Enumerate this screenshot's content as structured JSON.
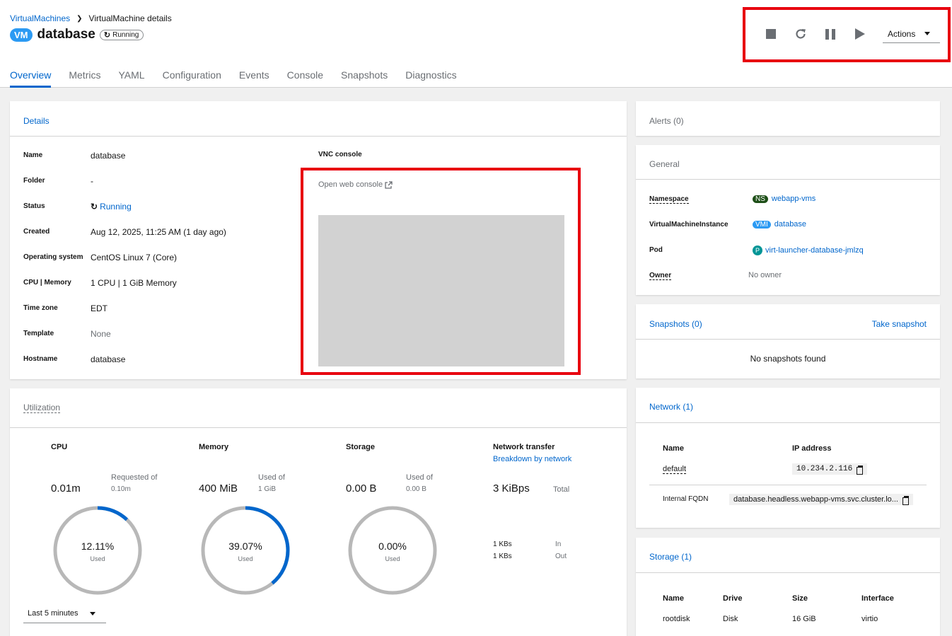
{
  "breadcrumb": {
    "parent": "VirtualMachines",
    "current": "VirtualMachine details"
  },
  "header": {
    "badge": "VM",
    "title": "database",
    "status": "Running",
    "actions_label": "Actions"
  },
  "tabs": [
    "Overview",
    "Metrics",
    "YAML",
    "Configuration",
    "Events",
    "Console",
    "Snapshots",
    "Diagnostics"
  ],
  "details": {
    "title": "Details",
    "fields": [
      {
        "label": "Name",
        "value": "database"
      },
      {
        "label": "Folder",
        "value": "-"
      },
      {
        "label": "Status",
        "value": "Running"
      },
      {
        "label": "Created",
        "value": "Aug 12, 2025, 11:25 AM (1 day ago)"
      },
      {
        "label": "Operating system",
        "value": "CentOS Linux 7 (Core)"
      },
      {
        "label": "CPU | Memory",
        "value": "1 CPU | 1 GiB Memory"
      },
      {
        "label": "Time zone",
        "value": "EDT"
      },
      {
        "label": "Template",
        "value": "None"
      },
      {
        "label": "Hostname",
        "value": "database"
      }
    ],
    "vnc_title": "VNC console",
    "vnc_link": "Open web console"
  },
  "alerts": {
    "title": "Alerts (0)"
  },
  "general": {
    "title": "General",
    "namespace_label": "Namespace",
    "namespace_badge": "NS",
    "namespace_value": "webapp-vms",
    "vmi_label": "VirtualMachineInstance",
    "vmi_badge": "VMI",
    "vmi_value": "database",
    "pod_label": "Pod",
    "pod_badge": "P",
    "pod_value": "virt-launcher-database-jmlzq",
    "owner_label": "Owner",
    "owner_value": "No owner"
  },
  "snapshots": {
    "title": "Snapshots (0)",
    "action": "Take snapshot",
    "empty": "No snapshots found"
  },
  "network": {
    "title": "Network (1)",
    "col_name": "Name",
    "col_ip": "IP address",
    "row_name": "default",
    "row_ip": "10.234.2.116",
    "fqdn_label": "Internal FQDN",
    "fqdn_value": "database.headless.webapp-vms.svc.cluster.lo..."
  },
  "storage": {
    "title": "Storage (1)",
    "columns": [
      "Name",
      "Drive",
      "Size",
      "Interface"
    ],
    "row": [
      "rootdisk",
      "Disk",
      "16 GiB",
      "virtio"
    ]
  },
  "utilization": {
    "title": "Utilization",
    "time_range": "Last 5 minutes",
    "cpu": {
      "title": "CPU",
      "value": "0.01m",
      "of_label": "Requested of",
      "of_value": "0.10m",
      "percent_text": "12.11%",
      "used": "Used",
      "fraction": 0.1211
    },
    "memory": {
      "title": "Memory",
      "value": "400 MiB",
      "of_label": "Used of",
      "of_value": "1 GiB",
      "percent_text": "39.07%",
      "used": "Used",
      "fraction": 0.3907
    },
    "storage": {
      "title": "Storage",
      "value": "0.00 B",
      "of_label": "Used of",
      "of_value": "0.00 B",
      "percent_text": "0.00%",
      "used": "Used",
      "fraction": 0
    },
    "network": {
      "title": "Network transfer",
      "link": "Breakdown by network",
      "value": "3 KiBps",
      "total": "Total",
      "in_value": "1 KBs",
      "in_label": "In",
      "out_value": "1 KBs",
      "out_label": "Out"
    }
  },
  "colors": {
    "accent": "#0066cc",
    "badge_vm": "#2b9af3",
    "badge_ns": "#1e4f18",
    "badge_vmi": "#2b9af3",
    "badge_pod": "#009596",
    "highlight": "#e8000f",
    "donut_track": "#b8b8b8",
    "donut_fill": "#0066cc"
  }
}
